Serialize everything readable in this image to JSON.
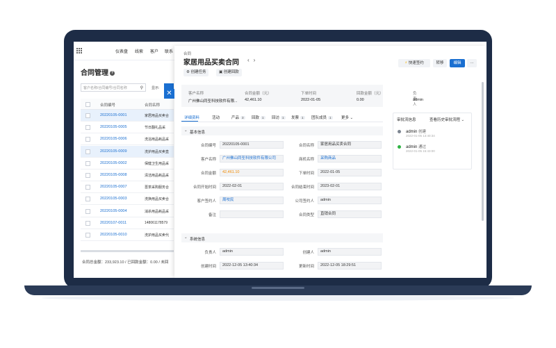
{
  "nav": {
    "items": [
      "仪表盘",
      "线索",
      "客户",
      "联系"
    ]
  },
  "list": {
    "title": "合同管理",
    "search_placeholder": "客户名称/合同编号/合同名称",
    "display_label": "显示:",
    "columns": [
      "合同编号",
      "合同名称"
    ],
    "rows": [
      {
        "id": "20220105-0001",
        "name": "家居用品买卖合",
        "selected": true
      },
      {
        "id": "20220105-0005",
        "name": "节日翻礼品采",
        "selected": false
      },
      {
        "id": "20220105-0006",
        "name": "洗浴用品耗品采",
        "selected": false
      },
      {
        "id": "20220105-0009",
        "name": "洗护用品买卖直",
        "selected": true
      },
      {
        "id": "20220105-0002",
        "name": "保健卫生用品采",
        "selected": false
      },
      {
        "id": "20220105-0008",
        "name": "清洁用品耗品采",
        "selected": false
      },
      {
        "id": "20220105-0007",
        "name": "蔷茶采购服务合",
        "selected": false
      },
      {
        "id": "20220105-0003",
        "name": "洗换用品买卖合",
        "selected": false
      },
      {
        "id": "20220105-0004",
        "name": "消杀用品耗品采",
        "selected": false
      },
      {
        "id": "20220107-0011",
        "name": "14806117857​9",
        "selected": false
      },
      {
        "id": "20220105-0010",
        "name": "洗护用品买卖代",
        "selected": false
      }
    ],
    "footer": "合同总金额：233,923.10 / 已回款金额：0.00 / 未回"
  },
  "detail": {
    "breadcrumb": "合同",
    "title": "家居用品买卖合同",
    "buttons": {
      "quick_sign": "快速签约",
      "transfer": "转移",
      "edit": "编辑",
      "more": "···"
    },
    "actions": {
      "create_task": "创建任务",
      "create_payment": "创建回款"
    },
    "summary": [
      {
        "label": "客户名称",
        "value": "广州佛山同圣科技软件有限..."
      },
      {
        "label": "合同金额（元）",
        "value": "42,461.10"
      },
      {
        "label": "下单时间",
        "value": "2022-01-05"
      },
      {
        "label": "回款金额（元）",
        "value": "0.00"
      },
      {
        "label": "负责人",
        "value": "admin"
      }
    ],
    "tabs": [
      {
        "label": "详细资料",
        "badge": ""
      },
      {
        "label": "活动",
        "badge": ""
      },
      {
        "label": "产品",
        "badge": "3"
      },
      {
        "label": "回款",
        "badge": "1"
      },
      {
        "label": "回访",
        "badge": "1"
      },
      {
        "label": "发票",
        "badge": "1"
      },
      {
        "label": "团队成员",
        "badge": "1"
      },
      {
        "label": "更多",
        "badge": ""
      }
    ],
    "basic_section": "基本信息",
    "basic_fields": [
      {
        "label": "合同编号",
        "value": "20220105-0001",
        "style": ""
      },
      {
        "label": "合同名称",
        "value": "家居用品买卖合同",
        "style": ""
      },
      {
        "label": "客户名称",
        "value": "广州佛山同圣科技软件有限公司",
        "style": "link"
      },
      {
        "label": "商机名称",
        "value": "采购商品",
        "style": "link"
      },
      {
        "label": "合同金额",
        "value": "42,461.10",
        "style": "orange"
      },
      {
        "label": "下单时间",
        "value": "2022-01-05",
        "style": ""
      },
      {
        "label": "合同开始时间",
        "value": "2022-02-01",
        "style": ""
      },
      {
        "label": "合同结束时间",
        "value": "2023-02-01",
        "style": ""
      },
      {
        "label": "客户签约人",
        "value": "周咬民",
        "style": "link"
      },
      {
        "label": "公司签约人",
        "value": "admin",
        "style": ""
      },
      {
        "label": "备注",
        "value": "",
        "style": ""
      },
      {
        "label": "合同类型",
        "value": "直销合同",
        "style": ""
      }
    ],
    "system_section": "系统信息",
    "system_fields": [
      {
        "label": "负责人",
        "value": "admin"
      },
      {
        "label": "创建人",
        "value": "admin"
      },
      {
        "label": "创建时间",
        "value": "2022-12-05 13:40:34"
      },
      {
        "label": "更新时间",
        "value": "2022-12-05 18:29:51"
      }
    ],
    "approval": {
      "title": "审批流信息",
      "history": "查看历史审批流程",
      "steps": [
        {
          "name": "admin",
          "action": "创建",
          "time": "2022-01-05 13:40:34",
          "color": "#7d8591"
        },
        {
          "name": "admin",
          "action": "通过",
          "time": "2022-01-05 15:43:00",
          "color": "#2fb344"
        }
      ]
    }
  }
}
